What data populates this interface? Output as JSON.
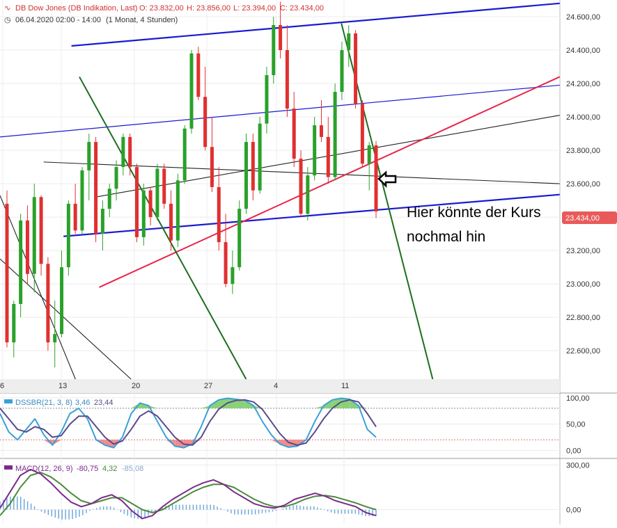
{
  "header": {
    "instrument": "DB Dow Jones (DB Indikation, Last)",
    "open": "O: 23.832,00",
    "high": "H: 23.856,00",
    "low": "L: 23.394,00",
    "close": "C: 23.434,00",
    "range": "06.04.2020 02:00 - 14:00",
    "interval": "(1 Monat, 4 Stunden)"
  },
  "price_badge": "23.434,00",
  "annotation": {
    "line1": "Hier könnte der Kurs",
    "line2": "nochmal hin"
  },
  "colors": {
    "bull": "#2aa12a",
    "bear": "#e03030",
    "channel": "#1a1ad0",
    "green_line": "#1e6e1e",
    "red_line": "#e8244a",
    "badge": "#e85a5a",
    "dss_fast": "#3aa0d8",
    "dss_slow": "#5a4a8a",
    "macd": "#7a2a8a",
    "signal": "#4a8a3a",
    "hist": "#6fa8dc"
  },
  "chart_data": [
    {
      "type": "candlestick",
      "title": "",
      "x_tick_labels": [
        "6",
        "13",
        "20",
        "27",
        "4",
        "11"
      ],
      "y_tick_labels": [
        "22.600,00",
        "22.800,00",
        "23.000,00",
        "23.200,00",
        "23.400,00",
        "23.600,00",
        "23.800,00",
        "24.000,00",
        "24.200,00",
        "24.400,00",
        "24.600,00"
      ],
      "ylim": [
        22430,
        24700
      ],
      "last_close": 23434,
      "trendlines": [
        {
          "kind": "channel",
          "from": [
            18,
            24425
          ],
          "to": [
            141,
            24680
          ]
        },
        {
          "kind": "channel",
          "from": [
            16,
            23285
          ],
          "to": [
            141,
            23535
          ]
        },
        {
          "kind": "thin_channel",
          "from": [
            0,
            23880
          ],
          "to": [
            141,
            24190
          ]
        },
        {
          "kind": "black",
          "from": [
            11,
            23730
          ],
          "to": [
            141,
            23600
          ]
        },
        {
          "kind": "black",
          "from": [
            24,
            23520
          ],
          "to": [
            141,
            24010
          ]
        },
        {
          "kind": "black",
          "from": [
            0,
            23530
          ],
          "to": [
            19,
            22430
          ]
        },
        {
          "kind": "black",
          "from": [
            0,
            23150
          ],
          "to": [
            33,
            22430
          ]
        },
        {
          "kind": "red",
          "from": [
            25,
            22980
          ],
          "to": [
            141,
            24240
          ]
        },
        {
          "kind": "green",
          "from": [
            20,
            24240
          ],
          "to": [
            62,
            22430
          ]
        },
        {
          "kind": "green",
          "from": [
            86,
            24560
          ],
          "to": [
            109,
            22430
          ]
        }
      ],
      "ohlc": [
        [
          23480,
          23560,
          22620,
          22650
        ],
        [
          22650,
          22900,
          22560,
          22880
        ],
        [
          22880,
          23420,
          22800,
          23380
        ],
        [
          23380,
          23470,
          23000,
          23060
        ],
        [
          23060,
          23600,
          22950,
          23520
        ],
        [
          23520,
          23530,
          23050,
          23120
        ],
        [
          23120,
          23160,
          22600,
          22650
        ],
        [
          22650,
          22900,
          22500,
          22700
        ],
        [
          22700,
          23200,
          22680,
          23100
        ],
        [
          23100,
          23500,
          23050,
          23480
        ],
        [
          23480,
          23600,
          23300,
          23320
        ],
        [
          23320,
          23700,
          23300,
          23680
        ],
        [
          23680,
          23900,
          23500,
          23850
        ],
        [
          23850,
          23880,
          23250,
          23300
        ],
        [
          23300,
          23500,
          23200,
          23450
        ],
        [
          23450,
          23600,
          23400,
          23570
        ],
        [
          23570,
          23740,
          23500,
          23700
        ],
        [
          23700,
          23900,
          23650,
          23880
        ],
        [
          23880,
          23900,
          23650,
          23700
        ],
        [
          23700,
          23720,
          23250,
          23280
        ],
        [
          23280,
          23600,
          23230,
          23560
        ],
        [
          23560,
          23580,
          23350,
          23400
        ],
        [
          23400,
          23720,
          23380,
          23690
        ],
        [
          23690,
          23720,
          23450,
          23480
        ],
        [
          23480,
          23560,
          23200,
          23260
        ],
        [
          23260,
          23660,
          23220,
          23620
        ],
        [
          23620,
          23950,
          23600,
          23930
        ],
        [
          23930,
          24400,
          23900,
          24380
        ],
        [
          24380,
          24420,
          24100,
          24120
        ],
        [
          24120,
          24300,
          23800,
          23820
        ],
        [
          23820,
          24000,
          23550,
          23580
        ],
        [
          23580,
          23700,
          23200,
          23250
        ],
        [
          23250,
          23420,
          22980,
          23000
        ],
        [
          23000,
          23200,
          22940,
          23100
        ],
        [
          23100,
          23500,
          23080,
          23450
        ],
        [
          23450,
          23900,
          23420,
          23850
        ],
        [
          23850,
          23900,
          23500,
          23560
        ],
        [
          23560,
          24000,
          23540,
          23960
        ],
        [
          23960,
          24300,
          23900,
          24250
        ],
        [
          24250,
          24600,
          24200,
          24550
        ],
        [
          24550,
          24690,
          24350,
          24400
        ],
        [
          24400,
          24550,
          24000,
          24050
        ],
        [
          24050,
          24150,
          23700,
          23750
        ],
        [
          23750,
          23800,
          23400,
          23420
        ],
        [
          23420,
          23700,
          23380,
          23650
        ],
        [
          23650,
          24000,
          23620,
          23950
        ],
        [
          23950,
          24100,
          23850,
          23880
        ],
        [
          23880,
          24000,
          23600,
          23640
        ],
        [
          23640,
          24200,
          23620,
          24150
        ],
        [
          24150,
          24450,
          24100,
          24400
        ],
        [
          24400,
          24550,
          24300,
          24500
        ],
        [
          24500,
          24520,
          24050,
          24080
        ],
        [
          24080,
          24100,
          23700,
          23720
        ],
        [
          23720,
          23850,
          23560,
          23830
        ],
        [
          23830,
          23856,
          23394,
          23434
        ]
      ]
    },
    {
      "type": "line",
      "indicator": "DSSBR(21, 3, 8)",
      "legend_values": [
        "3,46",
        "23,44"
      ],
      "y_tick_labels": [
        "100,00",
        "50,00",
        "0,00"
      ],
      "ylim": [
        -10,
        105
      ],
      "upper_band": 80,
      "lower_band": 20,
      "series": [
        {
          "name": "",
          "values": [
            70,
            35,
            20,
            40,
            60,
            30,
            10,
            35,
            70,
            80,
            60,
            20,
            10,
            5,
            25,
            70,
            90,
            85,
            55,
            25,
            8,
            5,
            12,
            45,
            85,
            96,
            99,
            97,
            95,
            85,
            55,
            30,
            12,
            6,
            8,
            20,
            55,
            85,
            96,
            99,
            97,
            85,
            40,
            25
          ]
        },
        {
          "name": "",
          "values": [
            80,
            60,
            40,
            35,
            45,
            40,
            25,
            28,
            50,
            65,
            65,
            45,
            25,
            12,
            18,
            40,
            65,
            75,
            65,
            45,
            25,
            12,
            10,
            25,
            55,
            78,
            90,
            95,
            96,
            92,
            78,
            55,
            32,
            15,
            10,
            14,
            35,
            60,
            80,
            92,
            96,
            92,
            70,
            45
          ]
        }
      ]
    },
    {
      "type": "line",
      "indicator": "MACD(12, 26, 9)",
      "legend_values": [
        "-80,75",
        "4,32",
        "-85,08"
      ],
      "y_tick_labels": [
        "300,00",
        "0,00"
      ],
      "ylim": [
        -100,
        330
      ],
      "series": [
        {
          "name": "",
          "values": [
            10,
            120,
            230,
            270,
            240,
            180,
            110,
            50,
            20,
            40,
            80,
            100,
            60,
            -10,
            -60,
            -40,
            20,
            70,
            110,
            150,
            180,
            200,
            170,
            120,
            80,
            40,
            20,
            10,
            30,
            70,
            90,
            110,
            90,
            60,
            40,
            20,
            -20,
            -40
          ]
        },
        {
          "name": "",
          "values": [
            -40,
            40,
            150,
            230,
            250,
            220,
            170,
            110,
            60,
            40,
            60,
            80,
            80,
            40,
            0,
            -20,
            0,
            40,
            80,
            120,
            150,
            170,
            170,
            150,
            110,
            70,
            40,
            20,
            20,
            40,
            70,
            90,
            95,
            85,
            65,
            45,
            20,
            0
          ]
        }
      ]
    }
  ]
}
